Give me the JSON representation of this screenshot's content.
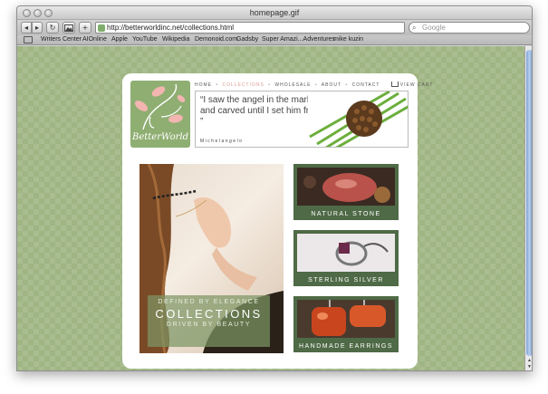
{
  "window": {
    "title": "homepage.gif"
  },
  "toolbar": {
    "back_label": "◂",
    "forward_label": "▸",
    "reload_label": "↻",
    "add_label": "+",
    "url": "http://betterworldinc.net/collections.html",
    "search_placeholder": "Google"
  },
  "bookmarks": [
    "Writers Center",
    "AIOnline",
    "Apple",
    "YouTube",
    "Wikipedia",
    "Demonoid.com",
    "Gadsby",
    "Super Amazi...Adventures",
    "mike kuzin"
  ],
  "site": {
    "logo_text": "BetterWorld",
    "nav": {
      "home": "HOME",
      "collections": "COLLECTIONS",
      "wholesale": "WHOLESALE",
      "about": "ABOUT",
      "contact": "CONTACT",
      "cart": "VIEW CART",
      "separator": "•"
    },
    "quote": {
      "text": "“I saw the angel in the marble and carved until I set him free. ”",
      "author": "Michelangelo"
    },
    "hero": {
      "line1": "DEFINED BY ELEGANCE",
      "line2": "COLLECTIONS",
      "line3": "DRIVEN BY BEAUTY"
    },
    "tiles": [
      "NATURAL STONE",
      "STERLING SILVER",
      "HANDMADE EARRINGS"
    ]
  },
  "colors": {
    "page_green": "#9fb583",
    "logo_green": "#8fae72",
    "tile_green": "#4f6a46",
    "nav_active": "#d99a8f"
  }
}
